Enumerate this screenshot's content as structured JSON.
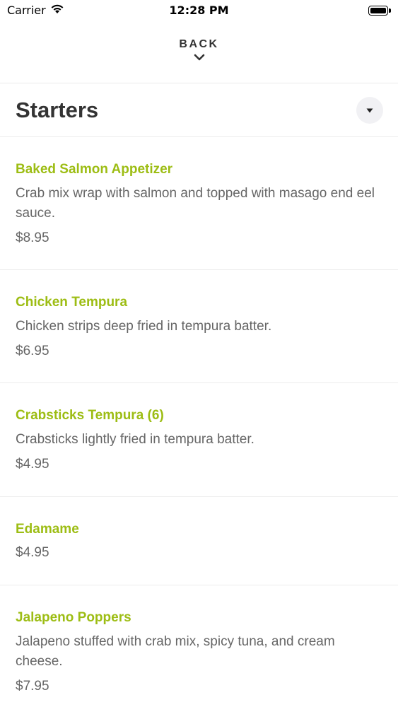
{
  "status_bar": {
    "carrier": "Carrier",
    "time": "12:28 PM",
    "wifi_icon": "wifi-icon",
    "battery_icon": "battery-icon"
  },
  "nav": {
    "back_label": "BACK",
    "back_icon": "chevron-down-icon"
  },
  "section": {
    "title": "Starters",
    "dropdown_icon": "caret-down-icon"
  },
  "items": [
    {
      "name": "Baked Salmon Appetizer",
      "description": "Crab mix wrap with salmon and topped with masago end eel sauce.",
      "price": "$8.95"
    },
    {
      "name": "Chicken Tempura",
      "description": "Chicken strips deep fried in tempura batter.",
      "price": "$6.95"
    },
    {
      "name": "Crabsticks Tempura (6)",
      "description": "Crabsticks lightly fried in tempura batter.",
      "price": "$4.95"
    },
    {
      "name": "Edamame",
      "description": "",
      "price": "$4.95"
    },
    {
      "name": "Jalapeno Poppers",
      "description": "Jalapeno stuffed with crab mix, spicy tuna, and cream cheese.",
      "price": "$7.95"
    }
  ],
  "colors": {
    "item_name": "#9dbd14",
    "text_secondary": "#666666",
    "title": "#333333",
    "divider": "#ececec"
  }
}
